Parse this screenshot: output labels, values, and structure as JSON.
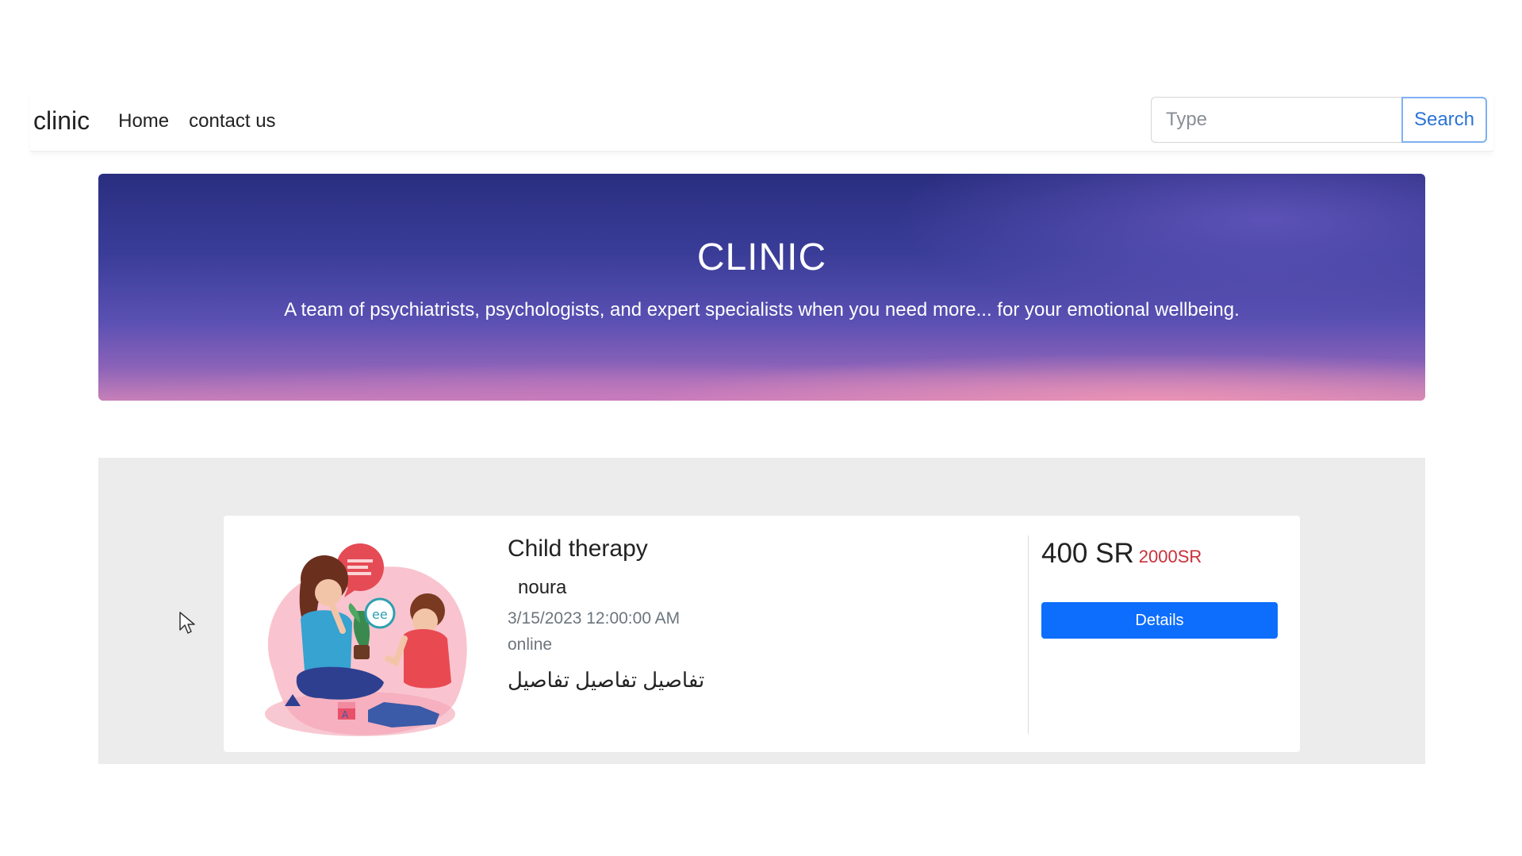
{
  "navbar": {
    "brand": "clinic",
    "links": [
      "Home",
      "contact us"
    ],
    "search_placeholder": "Type",
    "search_button": "Search"
  },
  "hero": {
    "title": "CLINIC",
    "subtitle": "A team of psychiatrists, psychologists, and expert specialists when you need more... for your emotional wellbeing."
  },
  "card": {
    "title": "Child therapy",
    "doctor": "noura",
    "date": "3/15/2023 12:00:00 AM",
    "mode": "online",
    "description": "تفاصيل تفاصيل تفاصيل",
    "price": "400 SR",
    "old_price": "2000SR",
    "details_button": "Details",
    "illustration": "child-therapy-illustration"
  },
  "colors": {
    "primary": "#0d6efd",
    "old_price": "#c9303a",
    "section_bg": "#ececec"
  }
}
